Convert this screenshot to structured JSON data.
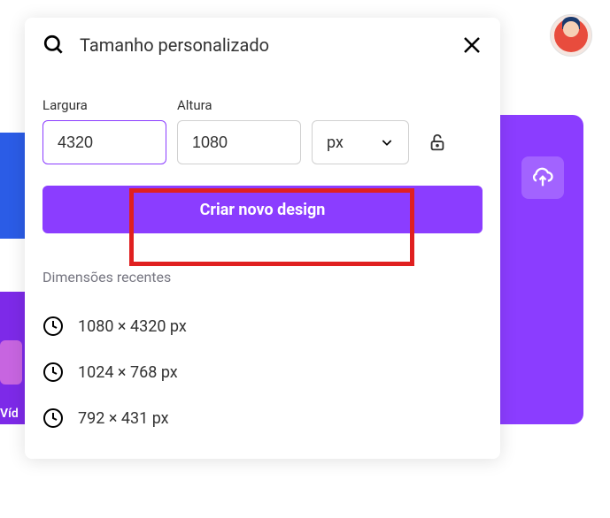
{
  "modal": {
    "title": "Tamanho personalizado",
    "labels": {
      "width": "Largura",
      "height": "Altura"
    },
    "width_value": "4320",
    "height_value": "1080",
    "unit": "px",
    "create_button": "Criar novo design"
  },
  "recent": {
    "title": "Dimensões recentes",
    "items": [
      "1080 × 4320 px",
      "1024 × 768 px",
      "792 × 431 px"
    ]
  },
  "sidebar": {
    "vid_label": "Víd"
  }
}
